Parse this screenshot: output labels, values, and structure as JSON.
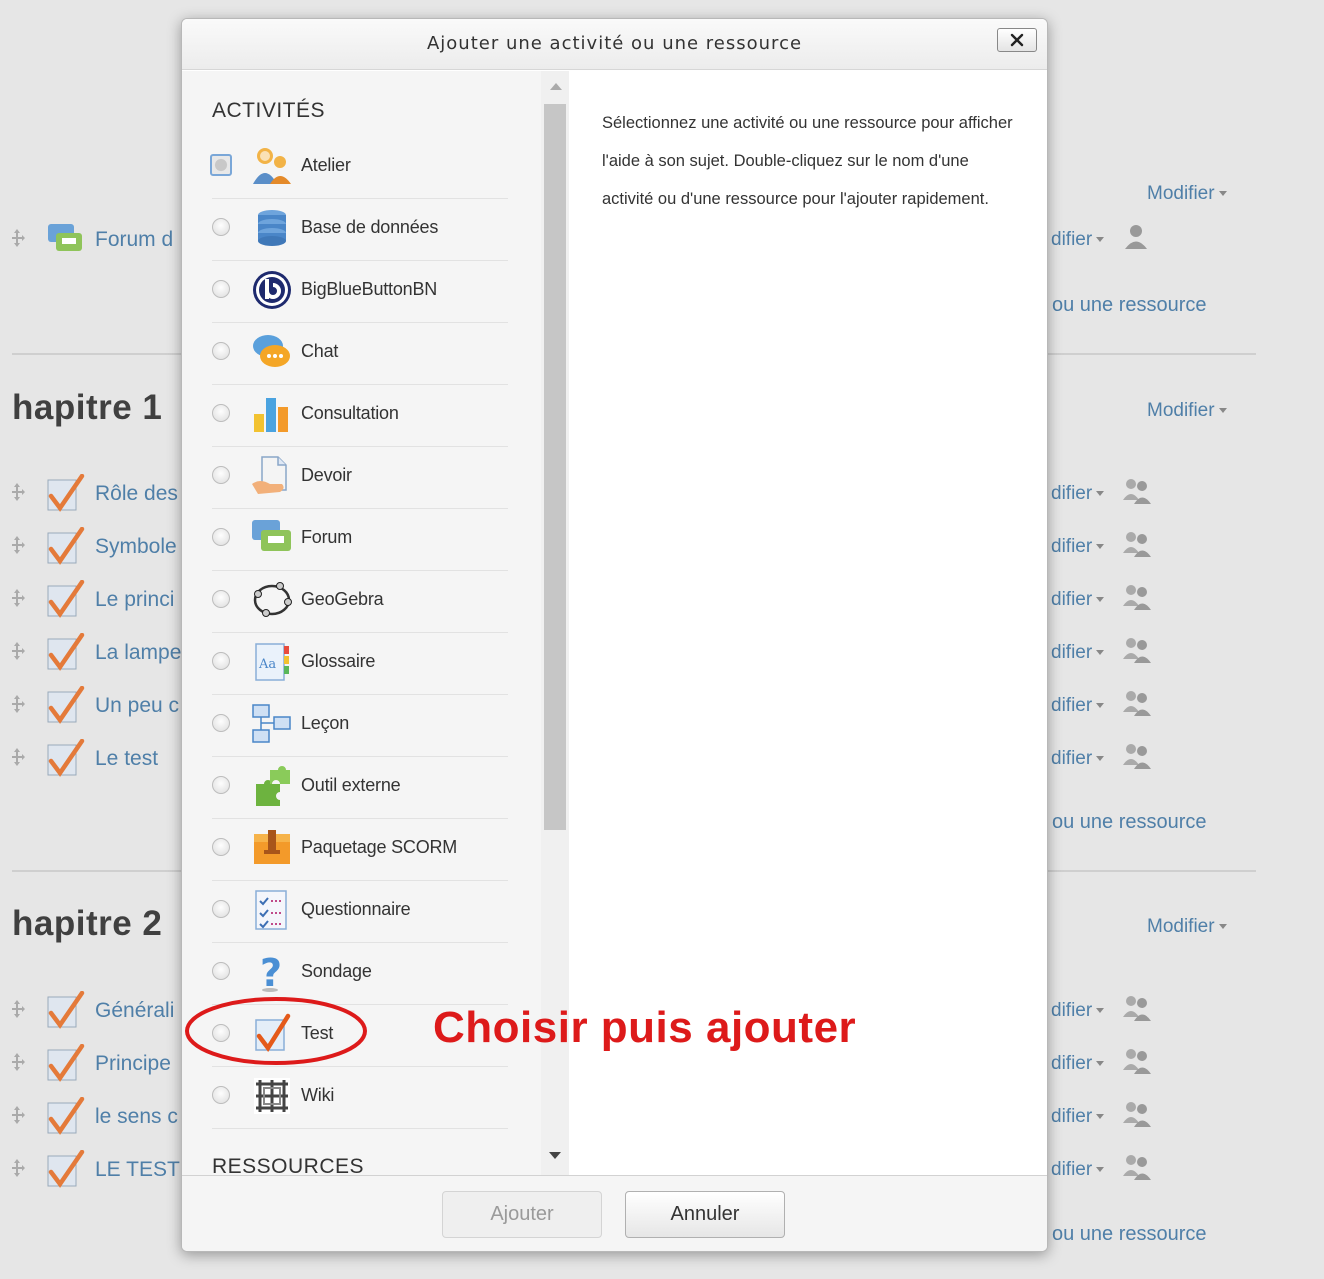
{
  "background": {
    "chapters": [
      "hapitre 1",
      "hapitre 2"
    ],
    "modifier_label": "Modifier",
    "modifier_partial": "difier",
    "add_resource_partial": "ou une ressource",
    "intro_item": "Forum d",
    "chapter1_items": [
      "Rôle des",
      "Symbole",
      "Le princi",
      "La lampe",
      "Un peu c",
      "Le test"
    ],
    "chapter2_items": [
      "Générali",
      "Principe",
      "le sens c",
      "LE TEST"
    ]
  },
  "modal": {
    "title": "Ajouter une activité ou une ressource",
    "activities_heading": "ACTIVITÉS",
    "resources_heading": "RESSOURCES",
    "activities": [
      {
        "label": "Atelier",
        "icon": "workshop-icon",
        "selected": true
      },
      {
        "label": "Base de données",
        "icon": "database-icon"
      },
      {
        "label": "BigBlueButtonBN",
        "icon": "bigbluebutton-icon"
      },
      {
        "label": "Chat",
        "icon": "chat-icon"
      },
      {
        "label": "Consultation",
        "icon": "chart-icon"
      },
      {
        "label": "Devoir",
        "icon": "assignment-icon"
      },
      {
        "label": "Forum",
        "icon": "forum-icon"
      },
      {
        "label": "GeoGebra",
        "icon": "geogebra-icon"
      },
      {
        "label": "Glossaire",
        "icon": "glossary-icon"
      },
      {
        "label": "Leçon",
        "icon": "lesson-icon"
      },
      {
        "label": "Outil externe",
        "icon": "puzzle-icon"
      },
      {
        "label": "Paquetage SCORM",
        "icon": "scorm-package-icon"
      },
      {
        "label": "Questionnaire",
        "icon": "questionnaire-icon"
      },
      {
        "label": "Sondage",
        "icon": "question-mark-icon"
      },
      {
        "label": "Test",
        "icon": "checkmark-icon"
      },
      {
        "label": "Wiki",
        "icon": "wiki-icon"
      }
    ],
    "help_text": "Sélectionnez une activité ou une ressource pour afficher l'aide à son sujet. Double-cliquez sur le nom d'une activité ou d'une ressource pour l'ajouter rapidement.",
    "add_button": "Ajouter",
    "cancel_button": "Annuler"
  },
  "annotation": {
    "text": "Choisir puis ajouter",
    "color": "#dd1a1a"
  }
}
